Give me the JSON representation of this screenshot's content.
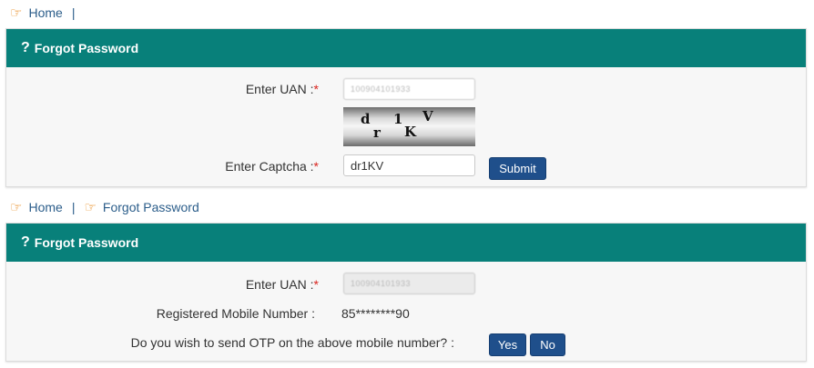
{
  "breadcrumb1": {
    "home": "Home",
    "separator": "|"
  },
  "breadcrumb2": {
    "home": "Home",
    "separator": "|",
    "forgot": "Forgot Password"
  },
  "panel1": {
    "title": "Forgot Password",
    "title_icon": "?",
    "uan_label": "Enter UAN :",
    "uan_value": "100904101933",
    "captcha_chars": [
      "d",
      "r",
      "1",
      "K",
      "V"
    ],
    "captcha_label": "Enter Captcha :",
    "captcha_value": "dr1KV",
    "submit": "Submit"
  },
  "panel2": {
    "title": "Forgot Password",
    "title_icon": "?",
    "uan_label": "Enter UAN :",
    "uan_value": "100904101933",
    "mobile_label": "Registered Mobile Number :",
    "mobile_value": "85********90",
    "otp_question": "Do you wish to send OTP on the above mobile number? :",
    "yes": "Yes",
    "no": "No"
  },
  "required_mark": "*",
  "icons": {
    "breadcrumb": "hand-pointing-right-icon",
    "title": "question-mark-icon"
  },
  "colors": {
    "header": "#08807a",
    "button": "#1f4f8b",
    "link": "#2b5d8a",
    "icon": "#e8891c",
    "required": "#d9241e"
  }
}
